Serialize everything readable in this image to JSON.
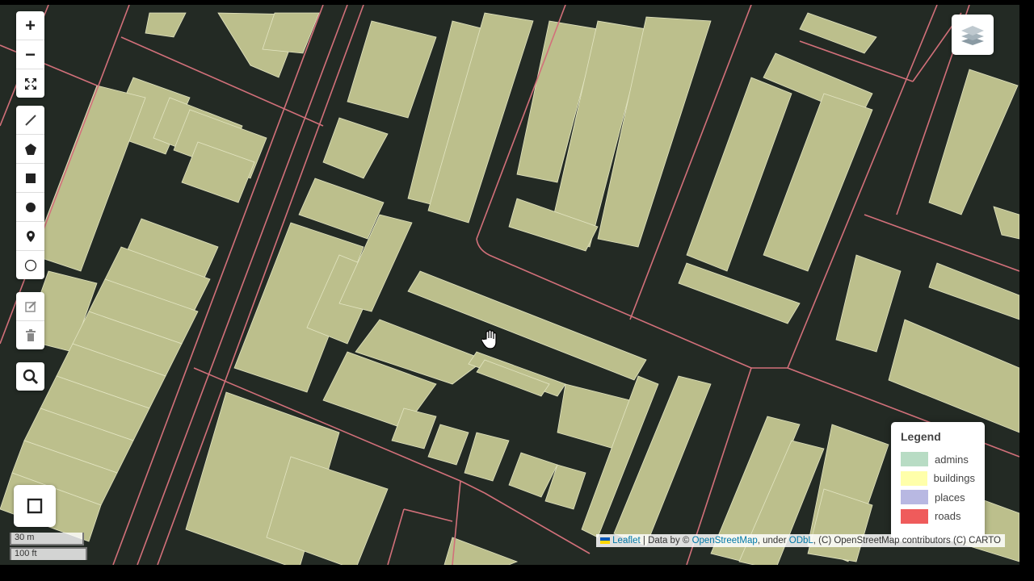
{
  "zoom": {
    "in_label": "+",
    "out_label": "−"
  },
  "legend": {
    "title": "Legend",
    "items": [
      {
        "label": "admins",
        "color": "#b8dcc4"
      },
      {
        "label": "buildings",
        "color": "#ffffaa"
      },
      {
        "label": "places",
        "color": "#b8b8e2"
      },
      {
        "label": "roads",
        "color": "#ef5b5b"
      }
    ]
  },
  "scale": {
    "metric": "30 m",
    "imperial": "100 ft"
  },
  "attribution": {
    "leaflet": "Leaflet",
    "sep1": " | Data by © ",
    "osm": "OpenStreetMap",
    "under": ", under ",
    "odbl": "ODbL",
    "rest": ", (C) OpenStreetMap contributors (C) CARTO"
  },
  "colors": {
    "map_bg": "#232a24",
    "building": "#bcbf8c",
    "building_edge": "#e2e4c0",
    "road": "#d2707a"
  },
  "icons": [
    "zoom-in-icon",
    "zoom-out-icon",
    "fullscreen-icon",
    "draw-polyline-icon",
    "draw-polygon-icon",
    "draw-rectangle-icon",
    "draw-circle-icon",
    "draw-marker-icon",
    "draw-circlemarker-icon",
    "edit-layers-icon",
    "delete-layers-icon",
    "search-icon",
    "layers-icon",
    "hand-cursor-icon"
  ]
}
